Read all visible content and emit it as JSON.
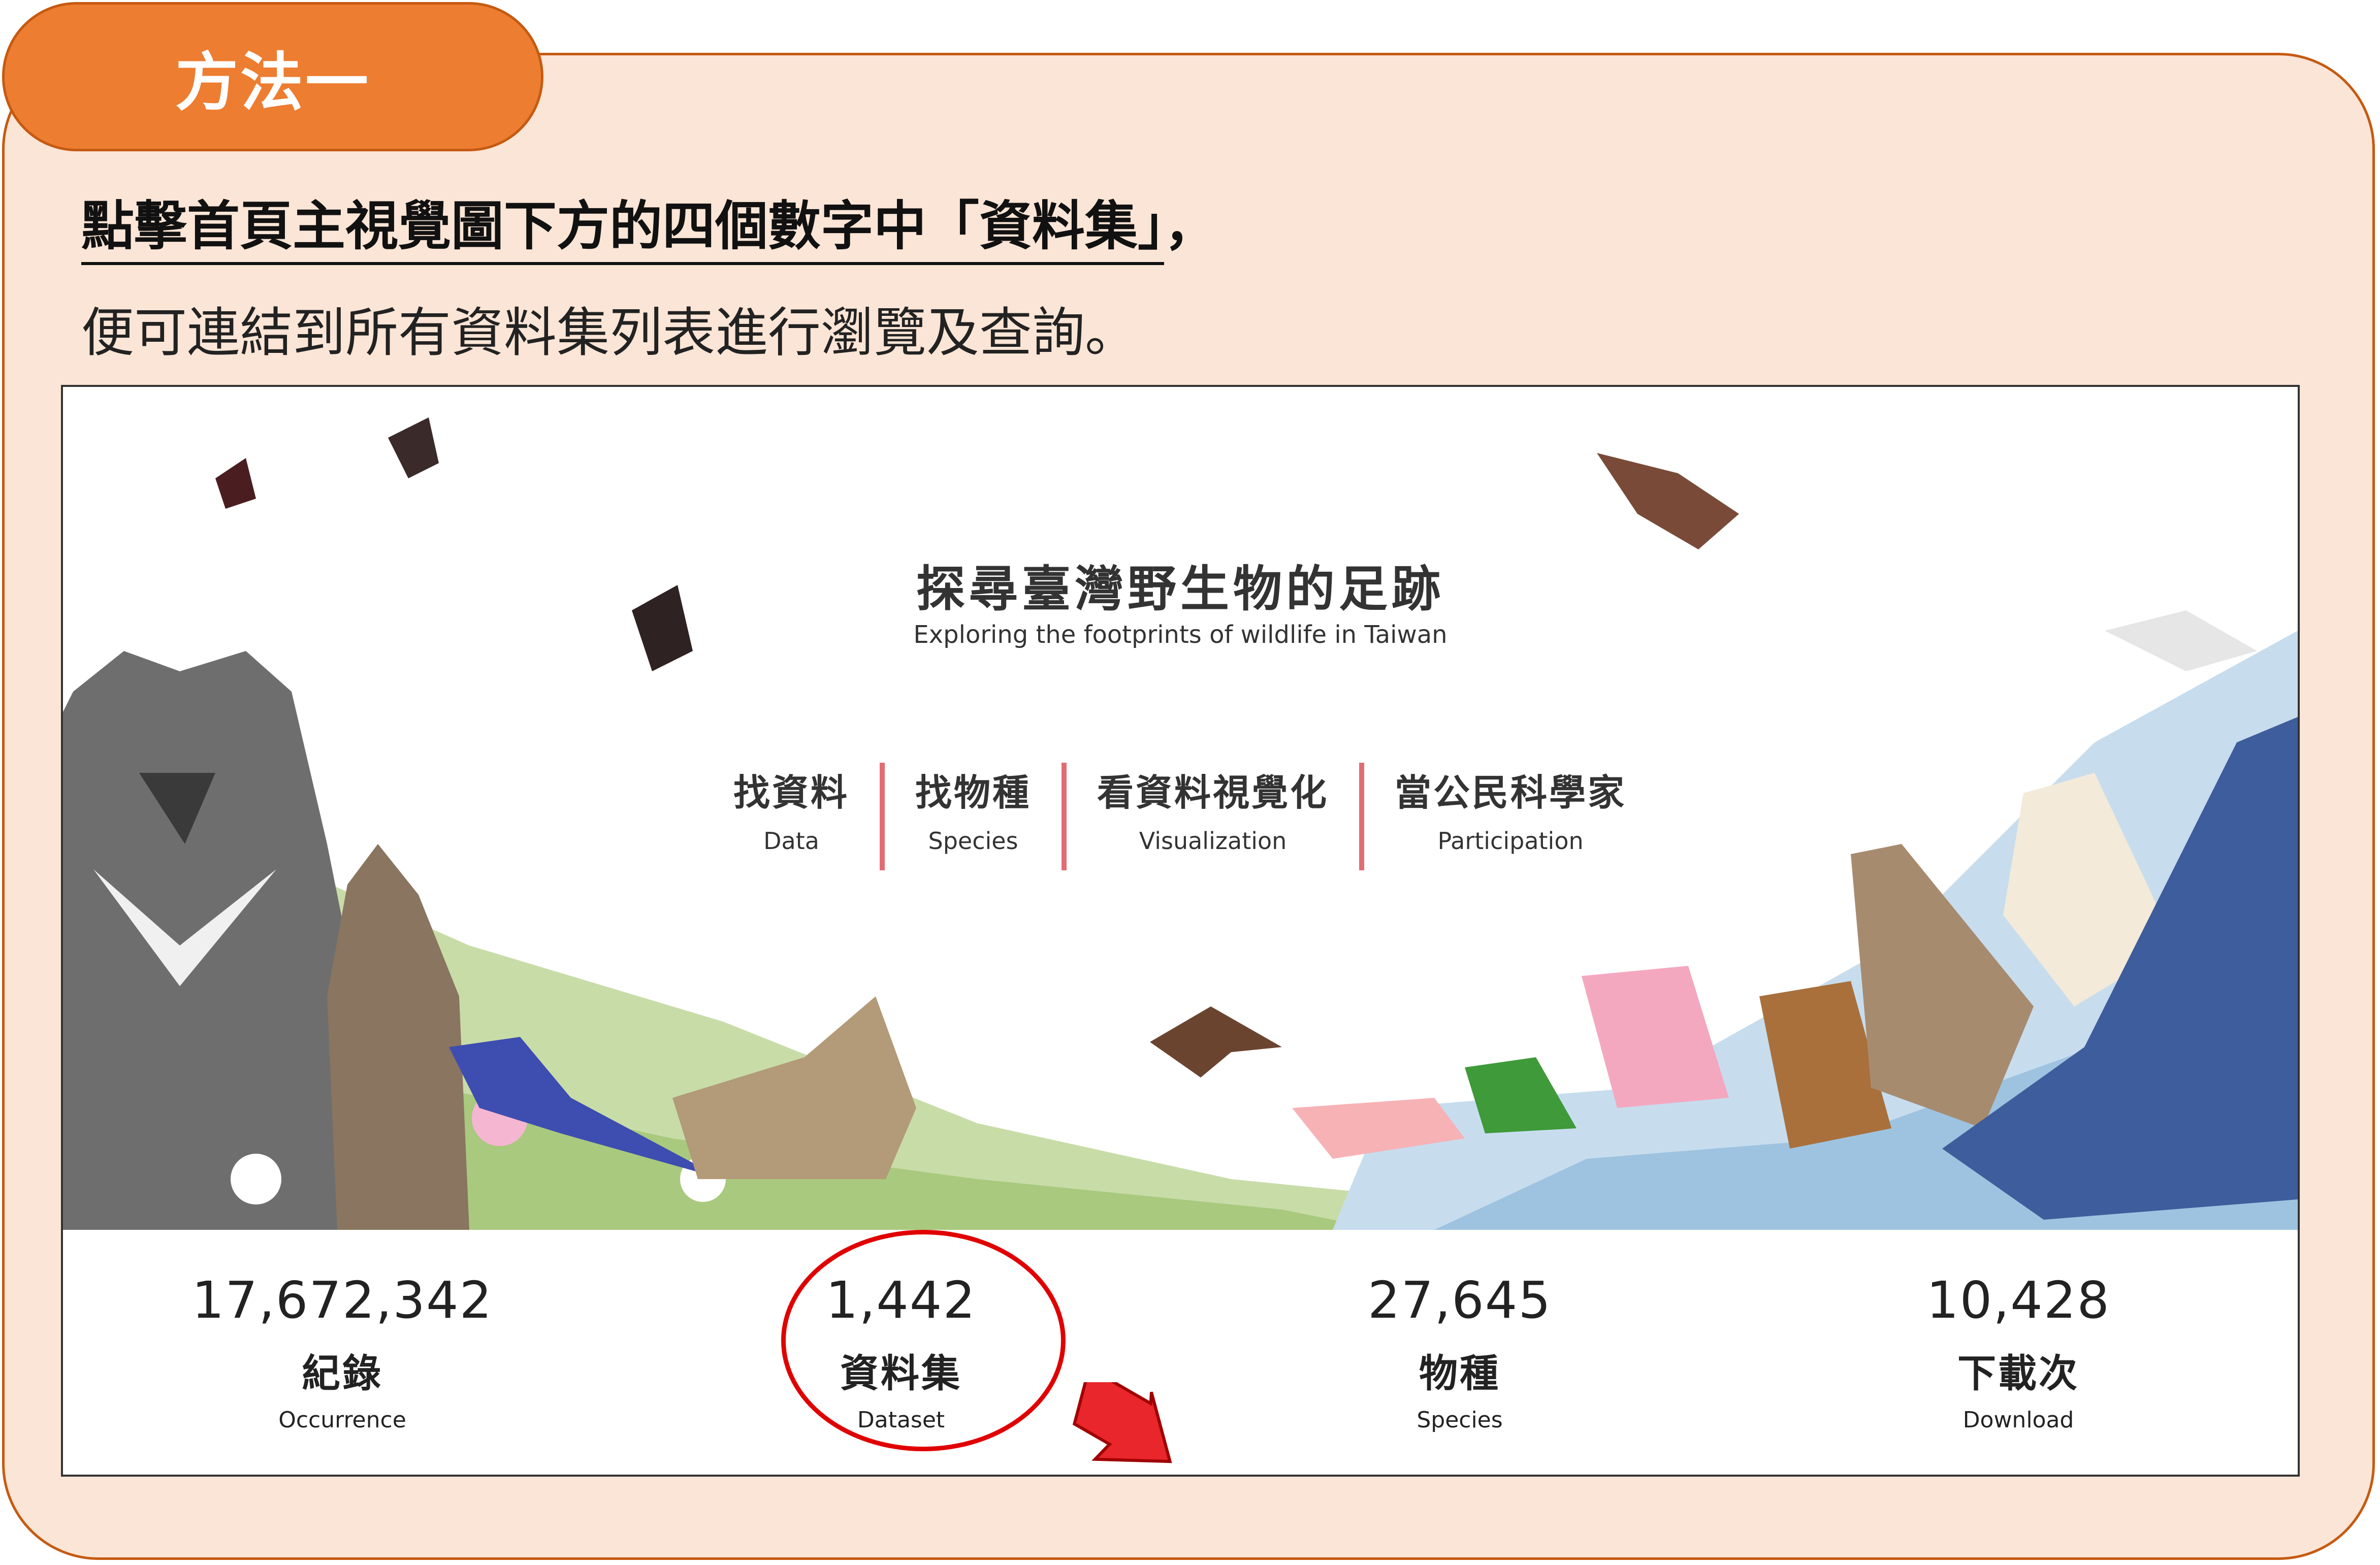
{
  "callout": {
    "tab_label": "方法一",
    "line1_main": "點擊首頁主視覺圖下方的四個數字中「資料集」",
    "line1_tail": "，",
    "line2": "便可連結到所有資料集列表進行瀏覽及查詢。"
  },
  "site": {
    "title": "探尋臺灣野生物的足跡",
    "subtitle": "Exploring the footprints of wildlife in Taiwan",
    "nav": [
      {
        "zh": "找資料",
        "en": "Data"
      },
      {
        "zh": "找物種",
        "en": "Species"
      },
      {
        "zh": "看資料視覺化",
        "en": "Visualization"
      },
      {
        "zh": "當公民科學家",
        "en": "Participation"
      }
    ],
    "stats": [
      {
        "value": "17,672,342",
        "zh": "紀錄",
        "en": "Occurrence"
      },
      {
        "value": "1,442",
        "zh": "資料集",
        "en": "Dataset"
      },
      {
        "value": "27,645",
        "zh": "物種",
        "en": "Species"
      },
      {
        "value": "10,428",
        "zh": "下載次",
        "en": "Download"
      }
    ]
  },
  "colors": {
    "tab_fill": "#ed7d31",
    "panel_fill": "#fbe5d6",
    "panel_border": "#c55a11",
    "nav_divider": "#e06d73",
    "highlight": "#e00000"
  },
  "icons": [
    "arrow-pointer-icon",
    "butterfly-icon",
    "bat-icon",
    "flying-squirrel-icon",
    "bear-icon",
    "whale-shark-icon",
    "egret-icon"
  ]
}
